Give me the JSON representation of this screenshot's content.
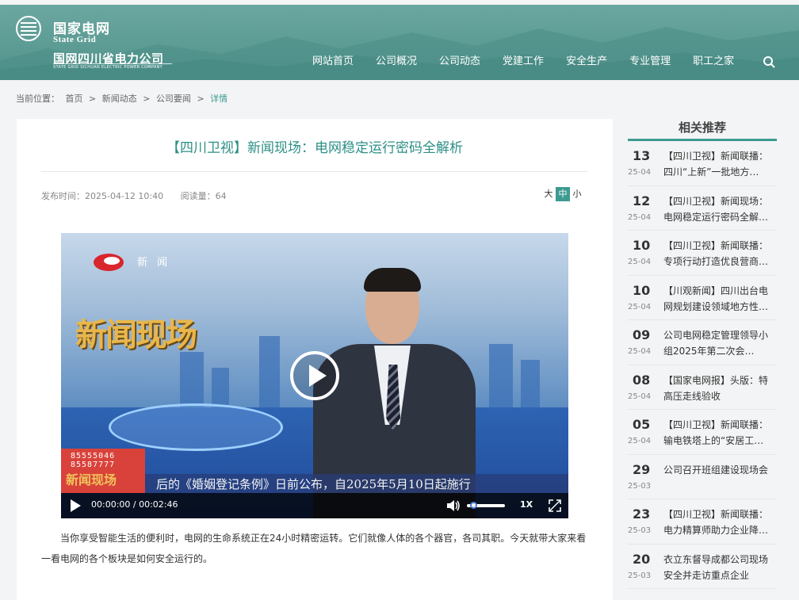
{
  "header": {
    "brand_cn": "国家电网",
    "brand_en": "State Grid",
    "company_cn": "国网四川省电力公司",
    "company_en": "STATE GRID SICHUAN ELECTRIC POWER COMPANY",
    "nav": [
      "网站首页",
      "公司概况",
      "公司动态",
      "党建工作",
      "安全生产",
      "专业管理",
      "职工之家"
    ],
    "search_icon": "search-icon"
  },
  "breadcrumb": {
    "prefix": "当前位置：",
    "items": [
      "首页",
      ">",
      "新闻动态",
      ">",
      "公司要闻",
      ">"
    ],
    "current": "详情"
  },
  "article": {
    "title": "【四川卫视】新闻现场：电网稳定运行密码全解析",
    "publish_time": "发布时间：2025-04-12 10:40",
    "read_count": "阅读量：64",
    "font_sizes": [
      "大",
      "中",
      "小"
    ],
    "paragraph": "当你享受智能生活的便利时，电网的生命系统正在24小时精密运转。它们就像人体的各个器官，各司其职。今天就带大家来看一看电网的各个板块是如何安全运行的。"
  },
  "video": {
    "channel_label": "新 闻",
    "show_title": "新闻现场",
    "ticker_numbers": [
      "85555046",
      "85587777"
    ],
    "ticker_logo": "新闻现场",
    "ticker_text": "后的《婚姻登记条例》日前公布，自2025年5月10日起施行",
    "time": "00:00:00 / 00:02:46",
    "speed": "1X",
    "volume": 0.1
  },
  "sidebar": {
    "title": "相关推荐",
    "items": [
      {
        "day": "13",
        "ym": "25-04",
        "text": "【四川卫视】新闻联播：四川“上新”一批地方…"
      },
      {
        "day": "12",
        "ym": "25-04",
        "text": "【四川卫视】新闻现场：电网稳定运行密码全解…"
      },
      {
        "day": "10",
        "ym": "25-04",
        "text": "【四川卫视】新闻联播：专项行动打造优良营商…"
      },
      {
        "day": "10",
        "ym": "25-04",
        "text": "【川观新闻】四川出台电网规划建设领域地方性…"
      },
      {
        "day": "09",
        "ym": "25-04",
        "text": "公司电网稳定管理领导小组2025年第二次会…"
      },
      {
        "day": "08",
        "ym": "25-04",
        "text": "【国家电网报】头版：特高压走线验收"
      },
      {
        "day": "05",
        "ym": "25-04",
        "text": "【四川卫视】新闻联播：输电铁塔上的“安居工…"
      },
      {
        "day": "29",
        "ym": "25-03",
        "text": "公司召开班组建设现场会"
      },
      {
        "day": "23",
        "ym": "25-03",
        "text": "【四川卫视】新闻联播：电力精算师助力企业降…"
      },
      {
        "day": "20",
        "ym": "25-03",
        "text": "衣立东督导成都公司现场安全并走访重点企业"
      }
    ]
  },
  "colors": {
    "accent": "#3d9a91",
    "header": "#5b9b93",
    "title": "#2d8f86"
  }
}
